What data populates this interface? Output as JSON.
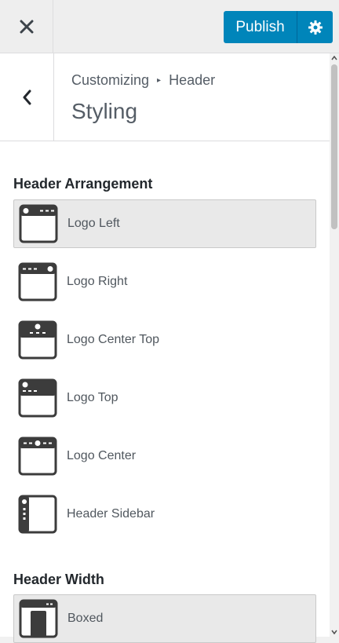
{
  "topbar": {
    "close_icon": "close-icon",
    "publish_label": "Publish",
    "settings_icon": "gear-icon",
    "accent": "#0085ba"
  },
  "panel": {
    "breadcrumb_parent": "Customizing",
    "breadcrumb_current": "Header",
    "title": "Styling"
  },
  "header_arrangement": {
    "title": "Header Arrangement",
    "options": [
      {
        "label": "Logo Left",
        "icon": "layout-logo-left-icon",
        "selected": true
      },
      {
        "label": "Logo Right",
        "icon": "layout-logo-right-icon",
        "selected": false
      },
      {
        "label": "Logo Center Top",
        "icon": "layout-logo-center-top-icon",
        "selected": false
      },
      {
        "label": "Logo Top",
        "icon": "layout-logo-top-icon",
        "selected": false
      },
      {
        "label": "Logo Center",
        "icon": "layout-logo-center-icon",
        "selected": false
      },
      {
        "label": "Header Sidebar",
        "icon": "layout-header-sidebar-icon",
        "selected": false
      }
    ]
  },
  "header_width": {
    "title": "Header Width",
    "options": [
      {
        "label": "Boxed",
        "icon": "layout-boxed-icon",
        "selected": true
      }
    ]
  }
}
